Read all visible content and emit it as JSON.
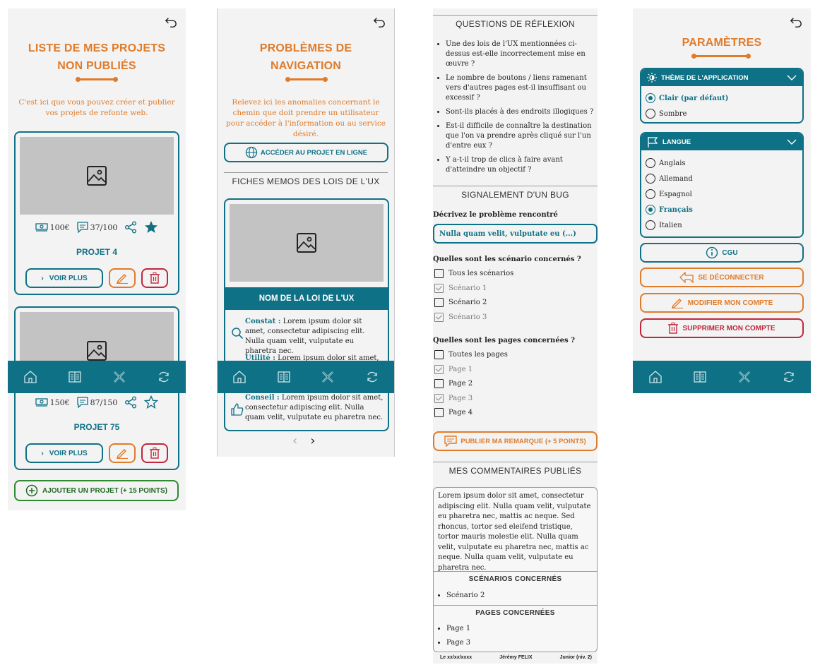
{
  "screen1": {
    "title_line1": "LISTE DE MES PROJETS",
    "title_line2": "NON PUBLIÉS",
    "intro": "C'est ici que vous pouvez créer et publier vos projets de refonte web.",
    "projects": [
      {
        "price": "100€",
        "comments": "37/100",
        "name": "PROJET 4",
        "favorite": true
      },
      {
        "price": "150€",
        "comments": "87/150",
        "name": "PROJET 75",
        "favorite": false
      }
    ],
    "voir_plus": "VOIR PLUS",
    "add_project": "AJOUTER UN PROJET (+ 15 POINTS)"
  },
  "screen2": {
    "title_line1": "PROBLÈMES DE",
    "title_line2": "NAVIGATION",
    "intro": "Relevez ici les anomalies concernant le chemin que doit prendre un utilisateur pour accéder à l'information ou au service désiré.",
    "access_button": "ACCÉDER AU PROJET EN LIGNE",
    "memo_heading": "FICHES MEMOS DES LOIS DE L'UX",
    "law_name": "NOM DE LA LOI DE L'UX",
    "constat_label": "Constat :",
    "constat_text": " Lorem ipsum dolor sit amet, consectetur adipiscing elit. Nulla quam velit, vulputate eu pharetra nec.",
    "utilite_label": "Utilité :",
    "utilite_text": " Lorem ipsum dolor sit amet,",
    "conseil_label": "Conseil :",
    "conseil_text": " Lorem ipsum dolor sit amet, consectetur adipiscing elit. Nulla quam velit, vulputate eu pharetra nec."
  },
  "screen3": {
    "reflection_heading": "QUESTIONS DE RÉFLEXION",
    "questions": [
      "Une des lois de l'UX mentionnées ci-dessus est-elle incorrectement mise en œuvre ?",
      "Le nombre de boutons / liens ramenant vers d'autres pages est-il insuffisant ou excessif ?",
      "Sont-ils placés à des endroits illogiques ?",
      "Est-il difficile de connaître la destination que l'on va prendre après cliqué sur l'un d'entre eux ?",
      "Y a-t-il trop de clics à faire avant d'atteindre un objectif ?"
    ],
    "bug_heading": "SIGNALEMENT D'UN BUG",
    "describe_label": "Décrivez le problème rencontré",
    "describe_value": "Nulla quam velit, vulputate eu (...)",
    "scenarios_label": "Quelles sont les scénario concernés ?",
    "scenarios": [
      {
        "label": "Tous les scénarios",
        "checked": false
      },
      {
        "label": "Scénario 1",
        "checked": true
      },
      {
        "label": "Scénario 2",
        "checked": false
      },
      {
        "label": "Scénario 3",
        "checked": true
      }
    ],
    "pages_label": "Quelles sont les pages concernées ?",
    "pages": [
      {
        "label": "Toutes les pages",
        "checked": false
      },
      {
        "label": "Page 1",
        "checked": true
      },
      {
        "label": "Page 2",
        "checked": false
      },
      {
        "label": "Page 3",
        "checked": true
      },
      {
        "label": "Page 4",
        "checked": false
      }
    ],
    "publish_button": "PUBLIER MA REMARQUE (+ 5 POINTS)",
    "comments_heading": "MES COMMENTAIRES PUBLIÉS",
    "comment_text": "Lorem ipsum dolor sit amet, consectetur adipiscing elit. Nulla quam velit, vulputate eu pharetra nec, mattis ac neque. Sed rhoncus, tortor sed eleifend tristique, tortor mauris molestie elit. Nulla quam velit, vulputate eu pharetra nec, mattis ac neque. Nulla quam velit, vulputate eu pharetra nec.",
    "comment_scenarios_heading": "SCÉNARIOS CONCERNÉS",
    "comment_scenarios": [
      "Scénario 2"
    ],
    "comment_pages_heading": "PAGES CONCERNÉES",
    "comment_pages": [
      "Page 1",
      "Page 3"
    ],
    "footer_date": "Le xx/xx/xxxx",
    "footer_author": "Jérémy FELIX",
    "footer_level": "Junior (niv. 2)"
  },
  "screen4": {
    "title": "PARAMÈTRES",
    "theme_heading": "THÈME DE L'APPLICATION",
    "themes": [
      {
        "label": "Clair (par défaut)",
        "selected": true
      },
      {
        "label": "Sombre",
        "selected": false
      }
    ],
    "lang_heading": "LANGUE",
    "languages": [
      {
        "label": "Anglais",
        "selected": false
      },
      {
        "label": "Allemand",
        "selected": false
      },
      {
        "label": "Espagnol",
        "selected": false
      },
      {
        "label": "Français",
        "selected": true
      },
      {
        "label": "Italien",
        "selected": false
      }
    ],
    "cgu": "CGU",
    "logout": "SE DÉCONNECTER",
    "edit_account": "MODIFIER MON COMPTE",
    "delete_account": "SUPPRIMER MON COMPTE"
  },
  "colors": {
    "teal": "#0f7185",
    "orange": "#e07b2a",
    "red": "#c0283c",
    "green": "#2f8a30",
    "panel_bg": "#f3f3f3"
  },
  "nav_icons": [
    "home-icon",
    "book-icon",
    "tools-icon",
    "refresh-icon"
  ]
}
